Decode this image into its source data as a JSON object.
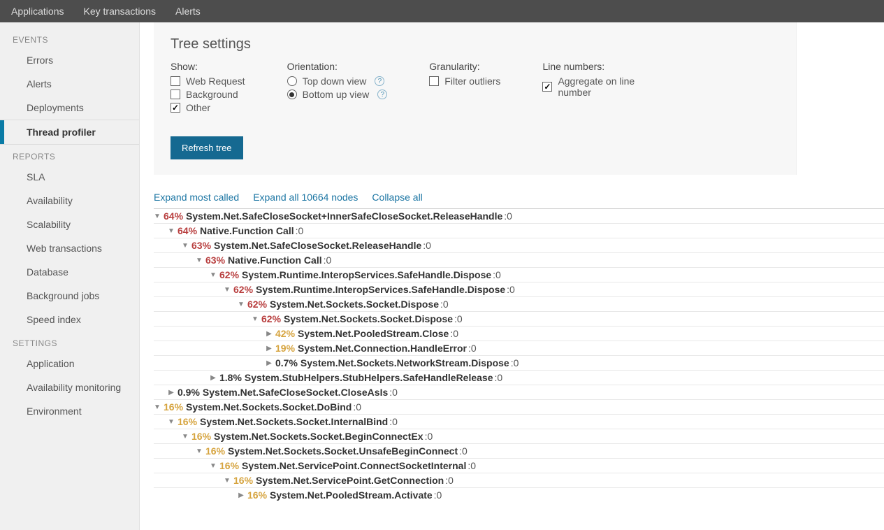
{
  "topnav": {
    "items": [
      "Applications",
      "Key transactions",
      "Alerts"
    ]
  },
  "sidebar": {
    "sections": [
      {
        "header": "EVENTS",
        "items": [
          {
            "label": "Errors"
          },
          {
            "label": "Alerts"
          },
          {
            "label": "Deployments"
          },
          {
            "label": "Thread profiler",
            "active": true
          }
        ]
      },
      {
        "header": "REPORTS",
        "items": [
          {
            "label": "SLA"
          },
          {
            "label": "Availability"
          },
          {
            "label": "Scalability"
          },
          {
            "label": "Web transactions"
          },
          {
            "label": "Database"
          },
          {
            "label": "Background jobs"
          },
          {
            "label": "Speed index"
          }
        ]
      },
      {
        "header": "SETTINGS",
        "items": [
          {
            "label": "Application"
          },
          {
            "label": "Availability monitoring"
          },
          {
            "label": "Environment"
          }
        ]
      }
    ]
  },
  "settings": {
    "title": "Tree settings",
    "show": {
      "label": "Show:",
      "web_request": "Web Request",
      "background": "Background",
      "other": "Other",
      "web_request_checked": false,
      "background_checked": false,
      "other_checked": true
    },
    "orientation": {
      "label": "Orientation:",
      "topdown": "Top down view",
      "bottomup": "Bottom up view",
      "selected": "bottomup"
    },
    "granularity": {
      "label": "Granularity:",
      "filter": "Filter outliers",
      "filter_checked": false
    },
    "linenumbers": {
      "label": "Line numbers:",
      "aggregate": "Aggregate on line number",
      "aggregate_checked": true
    },
    "refresh_label": "Refresh tree"
  },
  "tree_controls": {
    "expand_most": "Expand most called",
    "expand_all": "Expand all 10664 nodes",
    "collapse_all": "Collapse all"
  },
  "tree": [
    {
      "indent": 0,
      "expanded": true,
      "pct": "64%",
      "color": "red",
      "label": "System.Net.SafeCloseSocket+InnerSafeCloseSocket.ReleaseHandle",
      "suffix": ":0"
    },
    {
      "indent": 1,
      "expanded": true,
      "pct": "64%",
      "color": "red",
      "label": "Native.Function Call",
      "suffix": ":0"
    },
    {
      "indent": 2,
      "expanded": true,
      "pct": "63%",
      "color": "red",
      "label": "System.Net.SafeCloseSocket.ReleaseHandle",
      "suffix": ":0"
    },
    {
      "indent": 3,
      "expanded": true,
      "pct": "63%",
      "color": "red",
      "label": "Native.Function Call",
      "suffix": ":0"
    },
    {
      "indent": 4,
      "expanded": true,
      "pct": "62%",
      "color": "red",
      "label": "System.Runtime.InteropServices.SafeHandle.Dispose",
      "suffix": ":0"
    },
    {
      "indent": 5,
      "expanded": true,
      "pct": "62%",
      "color": "red",
      "label": "System.Runtime.InteropServices.SafeHandle.Dispose",
      "suffix": ":0"
    },
    {
      "indent": 6,
      "expanded": true,
      "pct": "62%",
      "color": "red",
      "label": "System.Net.Sockets.Socket.Dispose",
      "suffix": ":0"
    },
    {
      "indent": 7,
      "expanded": true,
      "pct": "62%",
      "color": "red",
      "label": "System.Net.Sockets.Socket.Dispose",
      "suffix": ":0"
    },
    {
      "indent": 8,
      "expanded": false,
      "pct": "42%",
      "color": "orange",
      "label": "System.Net.PooledStream.Close",
      "suffix": ":0"
    },
    {
      "indent": 8,
      "expanded": false,
      "pct": "19%",
      "color": "orange",
      "label": "System.Net.Connection.HandleError",
      "suffix": ":0"
    },
    {
      "indent": 8,
      "expanded": false,
      "pct": "0.7%",
      "color": "black",
      "label": "System.Net.Sockets.NetworkStream.Dispose",
      "suffix": ":0"
    },
    {
      "indent": 4,
      "expanded": false,
      "pct": "1.8%",
      "color": "black",
      "label": "System.StubHelpers.StubHelpers.SafeHandleRelease",
      "suffix": ":0"
    },
    {
      "indent": 1,
      "expanded": false,
      "pct": "0.9%",
      "color": "black",
      "label": "System.Net.SafeCloseSocket.CloseAsIs",
      "suffix": ":0"
    },
    {
      "indent": 0,
      "expanded": true,
      "pct": "16%",
      "color": "orange",
      "label": "System.Net.Sockets.Socket.DoBind",
      "suffix": ":0"
    },
    {
      "indent": 1,
      "expanded": true,
      "pct": "16%",
      "color": "orange",
      "label": "System.Net.Sockets.Socket.InternalBind",
      "suffix": ":0"
    },
    {
      "indent": 2,
      "expanded": true,
      "pct": "16%",
      "color": "orange",
      "label": "System.Net.Sockets.Socket.BeginConnectEx",
      "suffix": ":0"
    },
    {
      "indent": 3,
      "expanded": true,
      "pct": "16%",
      "color": "orange",
      "label": "System.Net.Sockets.Socket.UnsafeBeginConnect",
      "suffix": ":0"
    },
    {
      "indent": 4,
      "expanded": true,
      "pct": "16%",
      "color": "orange",
      "label": "System.Net.ServicePoint.ConnectSocketInternal",
      "suffix": ":0"
    },
    {
      "indent": 5,
      "expanded": true,
      "pct": "16%",
      "color": "orange",
      "label": "System.Net.ServicePoint.GetConnection",
      "suffix": ":0"
    },
    {
      "indent": 6,
      "expanded": false,
      "pct": "16%",
      "color": "orange",
      "label": "System.Net.PooledStream.Activate",
      "suffix": ":0"
    }
  ]
}
